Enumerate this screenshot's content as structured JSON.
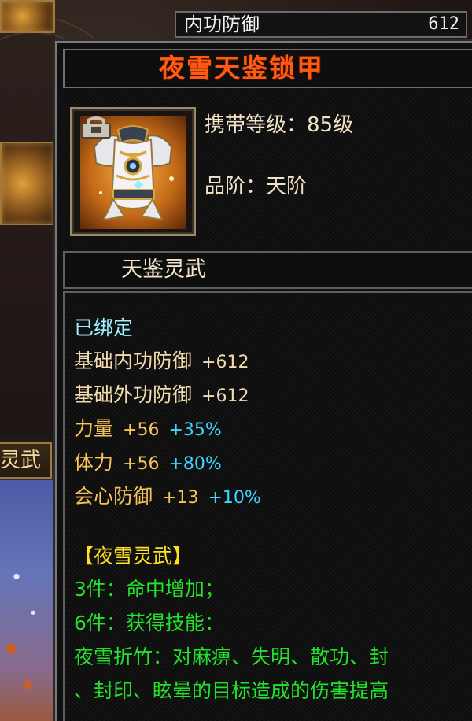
{
  "top_stat": {
    "label": "内功防御",
    "value": "612"
  },
  "background": {
    "tab_label": "灵武"
  },
  "item": {
    "name": "夜雪天鉴锁甲",
    "carry_level": "携带等级：85级",
    "grade": "品阶：天阶",
    "series": "天鉴灵武",
    "icon": "armor-icon",
    "bound_icon": "lock-icon"
  },
  "stats": {
    "bound": "已绑定",
    "base_inner_def": {
      "label": "基础内功防御",
      "value": "+612"
    },
    "base_outer_def": {
      "label": "基础外功防御",
      "value": "+612"
    },
    "strength": {
      "label": "力量",
      "value": "+56",
      "bonus": "+35%"
    },
    "stamina": {
      "label": "体力",
      "value": "+56",
      "bonus": "+80%"
    },
    "crit_def": {
      "label": "会心防御",
      "value": "+13",
      "bonus": "+10%"
    }
  },
  "set": {
    "title": "【夜雪灵武】",
    "bonus_3": "3件：命中增加；",
    "bonus_6": "6件：获得技能：",
    "skill_line1": "夜雪折竹：对麻痹、失明、散功、封",
    "skill_line2": "、封印、眩晕的目标造成的伤害提高"
  },
  "colors": {
    "title": "#ff5a14",
    "bound": "#9ff2ff",
    "base_stat": "#f2dcae",
    "attr_stat": "#f7c35a",
    "percent": "#3fd4ff",
    "set_title": "#ffe21f",
    "set_text": "#22e22a"
  }
}
